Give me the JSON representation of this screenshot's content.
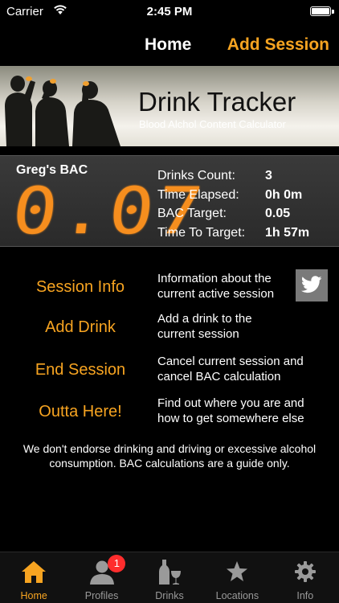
{
  "status_bar": {
    "carrier": "Carrier",
    "time": "2:45 PM"
  },
  "nav": {
    "title": "Home",
    "add_session": "Add Session"
  },
  "banner": {
    "title": "Drink Tracker",
    "subtitle": "Blood Alchol Content Calculator"
  },
  "bac": {
    "label": "Greg's BAC",
    "value": "0.07",
    "stats": [
      {
        "label": "Drinks Count:",
        "value": "3"
      },
      {
        "label": "Time Elapsed:",
        "value": "0h 0m"
      },
      {
        "label": "BAC Target:",
        "value": "0.05"
      },
      {
        "label": "Time To Target:",
        "value": "1h 57m"
      }
    ]
  },
  "actions": [
    {
      "label": "Session Info",
      "desc": "Information about the current active session"
    },
    {
      "label": "Add Drink",
      "desc": "Add a drink to the current session"
    },
    {
      "label": "End Session",
      "desc": "Cancel current session and cancel BAC calculation"
    },
    {
      "label": "Outta Here!",
      "desc": "Find out where you are and how to get somewhere else"
    }
  ],
  "disclaimer": "We don't endorse drinking and driving or excessive alcohol consumption. BAC calculations are a guide only.",
  "tabs": [
    {
      "label": "Home",
      "icon": "home-icon",
      "active": true
    },
    {
      "label": "Profiles",
      "icon": "person-icon",
      "badge": "1"
    },
    {
      "label": "Drinks",
      "icon": "drinks-icon"
    },
    {
      "label": "Locations",
      "icon": "star-icon"
    },
    {
      "label": "Info",
      "icon": "gear-icon"
    }
  ],
  "colors": {
    "accent": "#f7a421",
    "bac_digits": "#f68e1e",
    "badge": "#ff2d2d",
    "tab_inactive": "#9a9a9a"
  }
}
